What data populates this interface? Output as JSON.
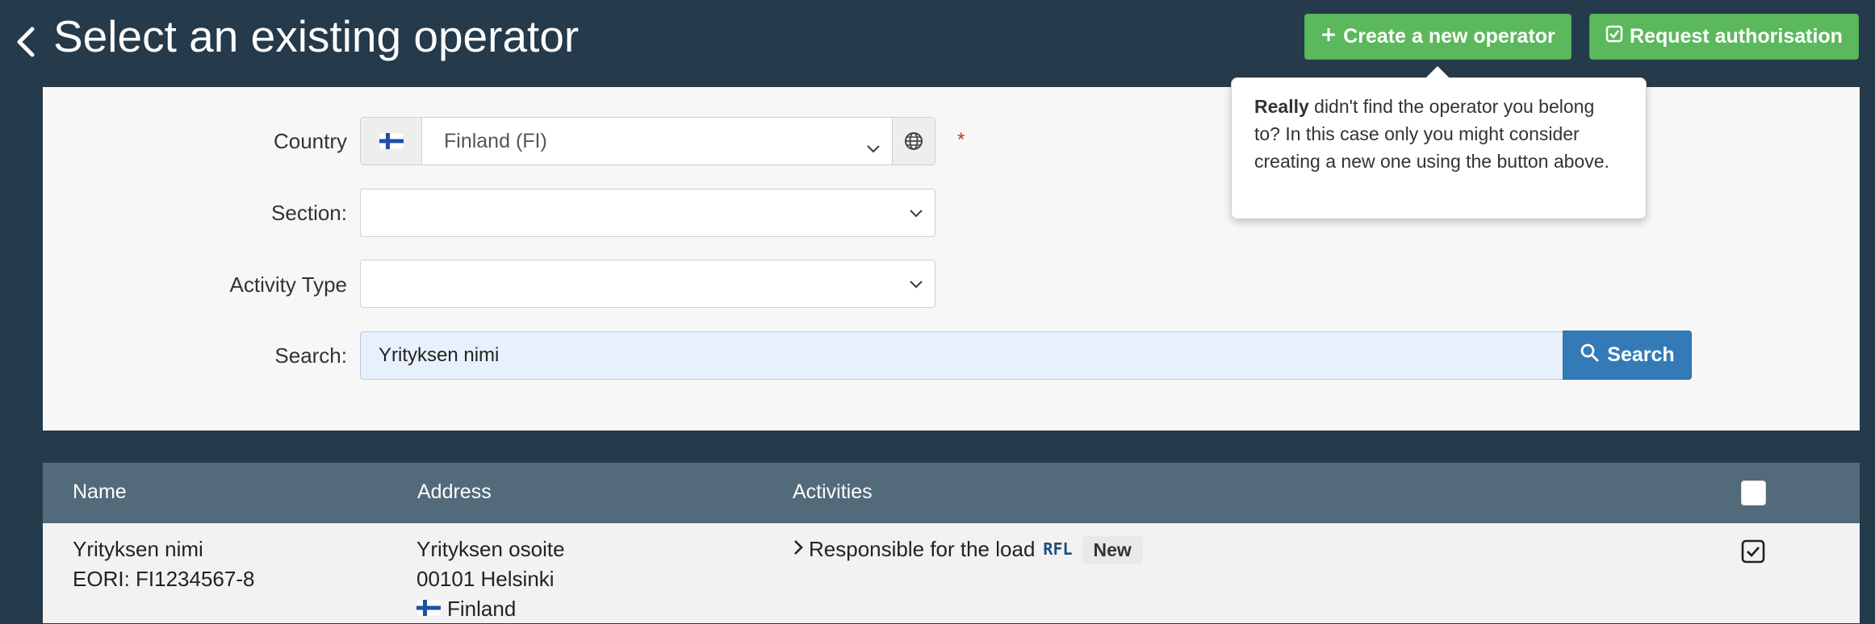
{
  "header": {
    "title": "Select an existing operator",
    "create_button_label": "Create a new operator",
    "request_button_label": "Request authorisation"
  },
  "popover": {
    "bold": "Really",
    "text": " didn't find the operator you belong to? In this case only you might consider creating a new one using the button above."
  },
  "form": {
    "country_label": "Country",
    "country_value": "Finland (FI)",
    "required_mark": "*",
    "section_label": "Section:",
    "section_value": "",
    "activity_type_label": "Activity Type",
    "activity_type_value": "",
    "search_label": "Search:",
    "search_value": "Yrityksen nimi",
    "search_button_label": "Search"
  },
  "table": {
    "columns": [
      "Name",
      "Address",
      "Activities"
    ],
    "rows": [
      {
        "name": "Yrityksen nimi",
        "eori": "EORI: FI1234567-8",
        "address_line1": "Yrityksen osoite",
        "address_line2": "00101 Helsinki",
        "country": "Finland",
        "activity": "Responsible for the load",
        "activity_code": "RFL",
        "badge": "New",
        "selected": true
      }
    ]
  },
  "colors": {
    "background": "#253a4b",
    "green": "#5cb85c",
    "blue": "#337ab7",
    "table_header": "#526a79"
  },
  "icons": [
    "chevron-left-icon",
    "plus-icon",
    "checkbox-icon",
    "finland-flag-icon",
    "globe-icon",
    "chevron-down-icon",
    "search-icon",
    "chevron-right-icon"
  ]
}
